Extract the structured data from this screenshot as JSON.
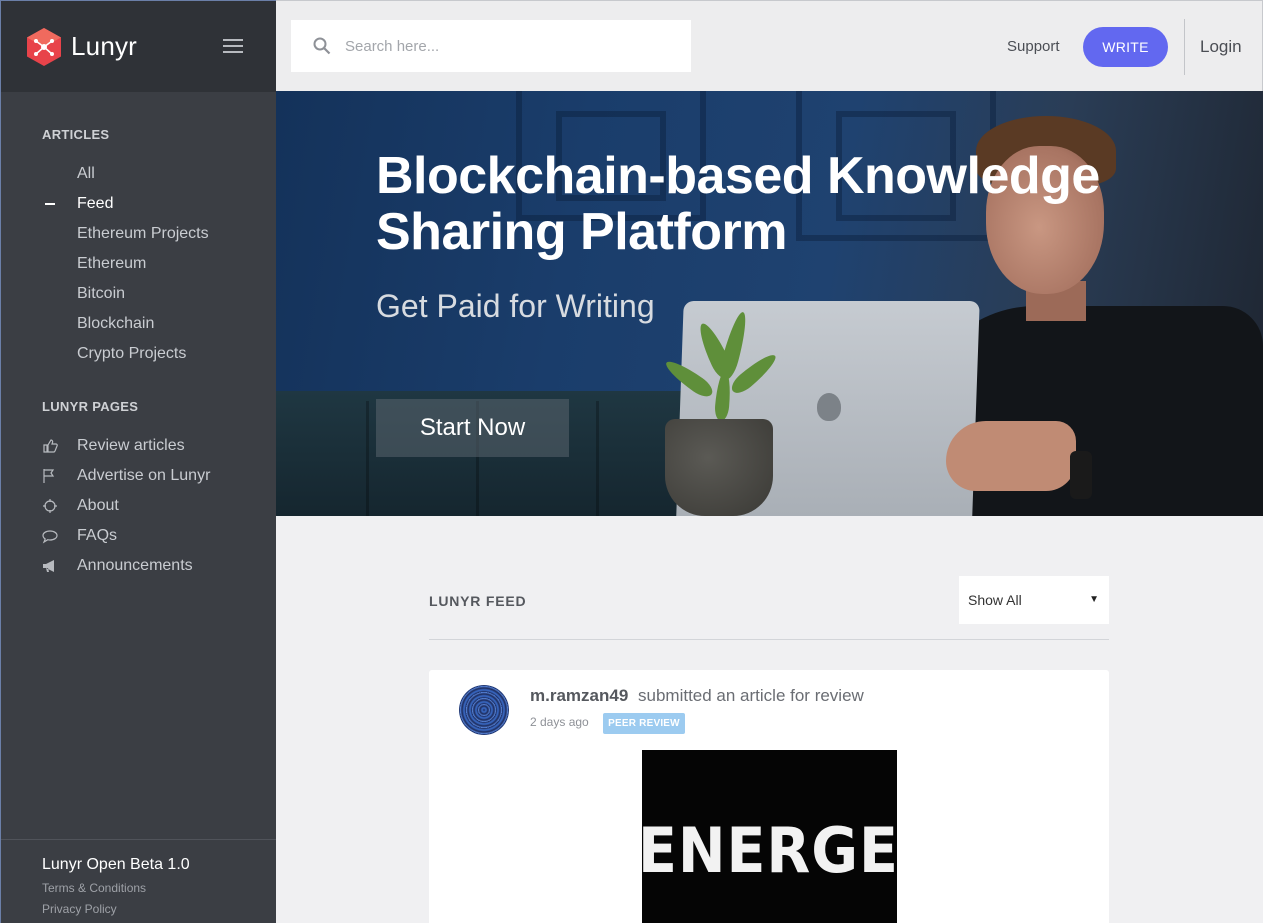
{
  "brand": {
    "name": "Lunyr",
    "accent": "#e8434a"
  },
  "search": {
    "placeholder": "Search here..."
  },
  "topbar": {
    "support": "Support",
    "write": "WRITE",
    "login": "Login"
  },
  "sidebar": {
    "articles_title": "ARTICLES",
    "articles": [
      {
        "label": "All"
      },
      {
        "label": "Feed",
        "active": true
      },
      {
        "label": "Ethereum Projects"
      },
      {
        "label": "Ethereum"
      },
      {
        "label": "Bitcoin"
      },
      {
        "label": "Blockchain"
      },
      {
        "label": "Crypto Projects"
      }
    ],
    "pages_title": "LUNYR PAGES",
    "pages": [
      {
        "label": "Review articles",
        "icon": "thumbs-up-icon"
      },
      {
        "label": "Advertise on Lunyr",
        "icon": "flag-icon"
      },
      {
        "label": "About",
        "icon": "crosshair-icon"
      },
      {
        "label": "FAQs",
        "icon": "chat-bubble-icon"
      },
      {
        "label": "Announcements",
        "icon": "megaphone-icon"
      }
    ],
    "footer": {
      "title": "Lunyr Open Beta 1.0",
      "terms": "Terms & Conditions",
      "privacy": "Privacy Policy"
    }
  },
  "hero": {
    "title": "Blockchain-based Knowledge Sharing Platform",
    "subtitle": "Get Paid for Writing",
    "cta": "Start Now"
  },
  "feed": {
    "label": "LUNYR FEED",
    "filter": "Show All",
    "items": [
      {
        "user": "m.ramzan49",
        "action": "submitted an article for review",
        "time": "2 days ago",
        "badge": "PEER REVIEW",
        "thumb_text": "ENERGET"
      }
    ]
  },
  "colors": {
    "write_button": "#6268f0",
    "badge": "#9ccbf0",
    "sidebar_bg": "#3b3e44"
  }
}
